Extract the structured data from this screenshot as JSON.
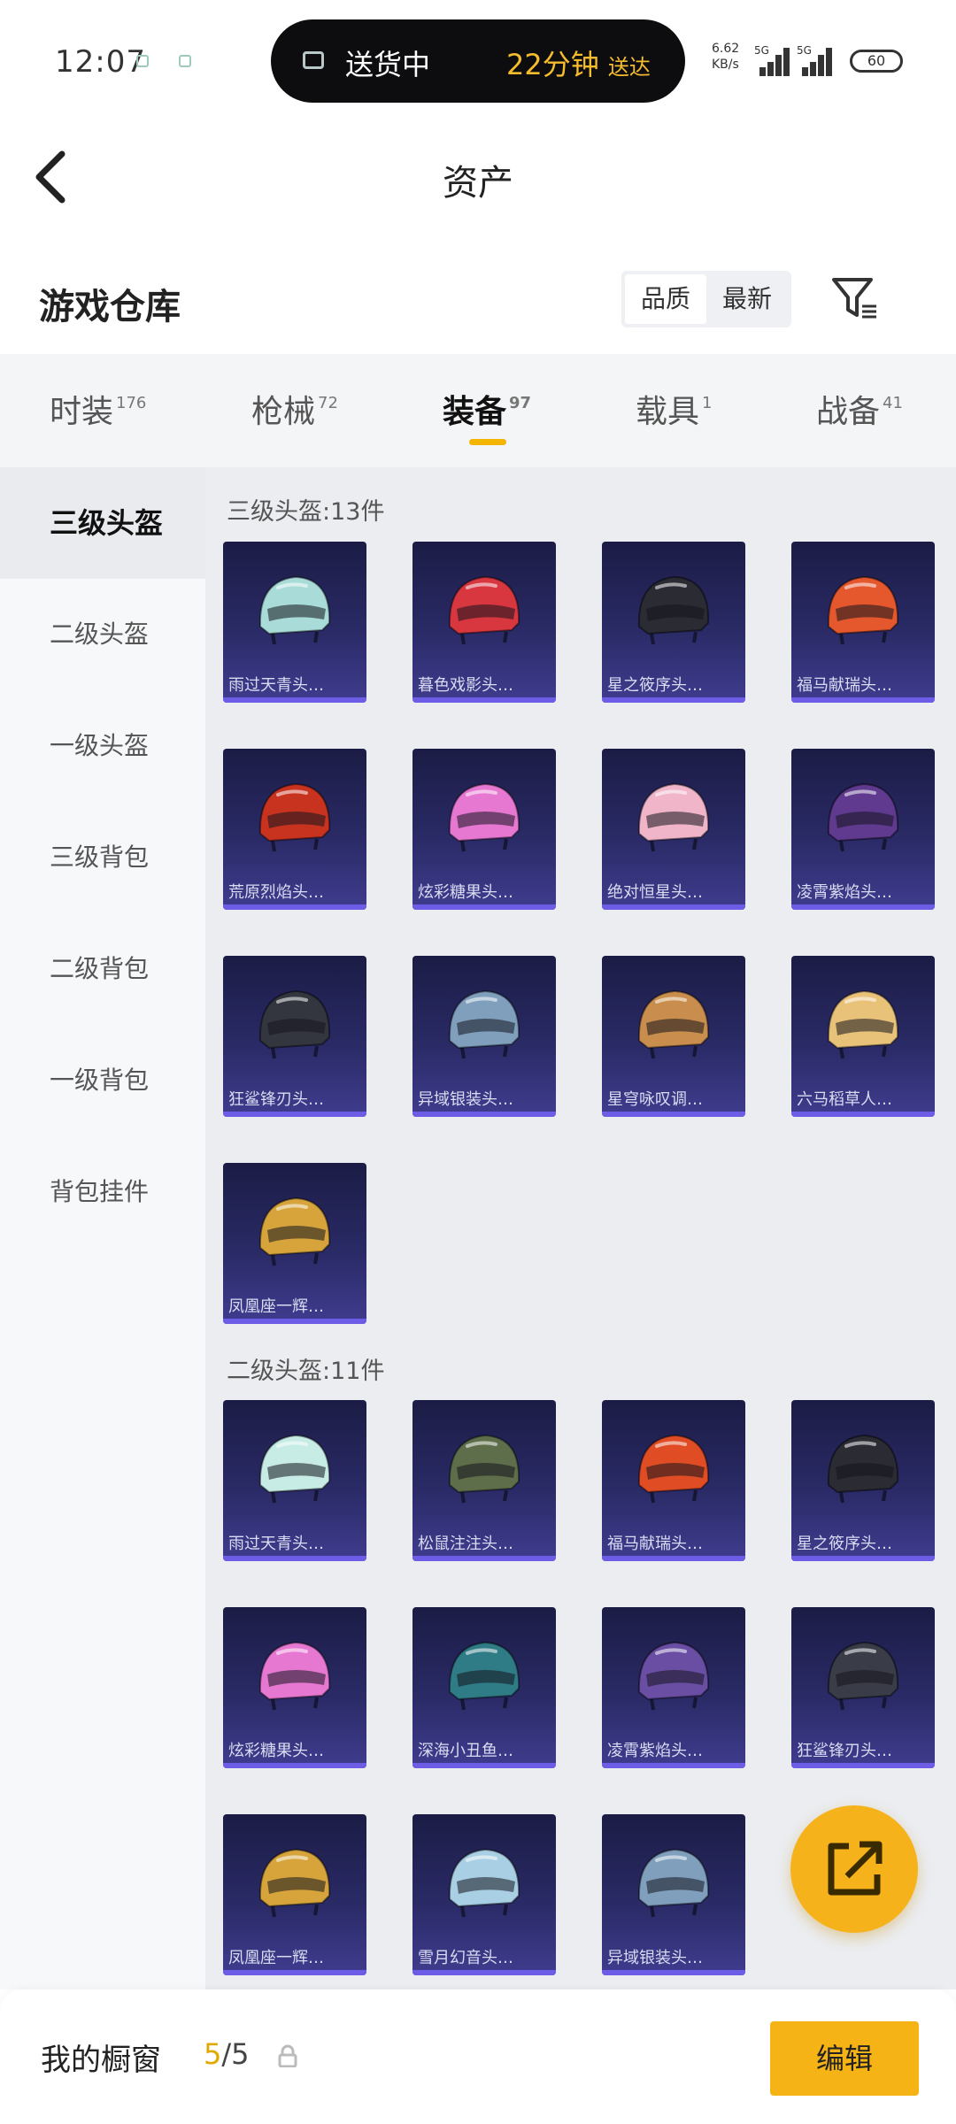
{
  "status_bar": {
    "time": "12:07",
    "pill_left": "送货中",
    "pill_time": "22分钟",
    "pill_suffix": "送达",
    "net_speed": "6.62",
    "net_unit": "KB/s",
    "sim1": "5G",
    "sim2": "5G",
    "battery": "60"
  },
  "header": {
    "title": "资产"
  },
  "section": {
    "title": "游戏仓库",
    "sort_options": [
      "品质",
      "最新"
    ]
  },
  "tabs": [
    {
      "label": "时装",
      "count": "176"
    },
    {
      "label": "枪械",
      "count": "72"
    },
    {
      "label": "装备",
      "count": "97"
    },
    {
      "label": "载具",
      "count": "1"
    },
    {
      "label": "战备",
      "count": "41"
    }
  ],
  "sidebar": [
    "三级头盔",
    "二级头盔",
    "一级头盔",
    "三级背包",
    "二级背包",
    "一级背包",
    "背包挂件"
  ],
  "groups": [
    {
      "title": "三级头盔:13件",
      "items": [
        {
          "label": "雨过天青头…",
          "color": "#a9dcd8"
        },
        {
          "label": "暮色戏影头…",
          "color": "#d8373f"
        },
        {
          "label": "星之筱序头…",
          "color": "#2b2b33"
        },
        {
          "label": "福马献瑞头…",
          "color": "#e5582d"
        },
        {
          "label": "荒原烈焰头…",
          "color": "#c8331f"
        },
        {
          "label": "炫彩糖果头…",
          "color": "#e778d2"
        },
        {
          "label": "绝对恒星头…",
          "color": "#f0b5c8"
        },
        {
          "label": "凌霄紫焰头…",
          "color": "#5f3a8f"
        },
        {
          "label": "狂鲨锋刃头…",
          "color": "#33363e"
        },
        {
          "label": "异域银装头…",
          "color": "#7f9fbd"
        },
        {
          "label": "星穹咏叹调…",
          "color": "#c98e4d"
        },
        {
          "label": "六马稻草人…",
          "color": "#e9c27a"
        },
        {
          "label": "凤凰座一辉…",
          "color": "#d6a43a"
        }
      ]
    },
    {
      "title": "二级头盔:11件",
      "items": [
        {
          "label": "雨过天青头…",
          "color": "#c6ece5"
        },
        {
          "label": "松鼠注注头…",
          "color": "#5f6e4a"
        },
        {
          "label": "福马献瑞头…",
          "color": "#e04d25"
        },
        {
          "label": "星之筱序头…",
          "color": "#2b2b33"
        },
        {
          "label": "炫彩糖果头…",
          "color": "#e778d2"
        },
        {
          "label": "深海小丑鱼…",
          "color": "#2f7b86"
        },
        {
          "label": "凌霄紫焰头…",
          "color": "#6a4ea4"
        },
        {
          "label": "狂鲨锋刃头…",
          "color": "#3a3d47"
        },
        {
          "label": "凤凰座一辉…",
          "color": "#d6a43a"
        },
        {
          "label": "雪月幻音头…",
          "color": "#a8cfe3"
        },
        {
          "label": "异域银装头…",
          "color": "#7f9fbd"
        }
      ]
    }
  ],
  "bottom": {
    "label": "我的橱窗",
    "count_current": "5",
    "count_total": "/5",
    "edit": "编辑"
  },
  "colors": {
    "accent": "#f5b315",
    "card_top": "#1b1c45",
    "card_bottom": "#403c8f"
  }
}
